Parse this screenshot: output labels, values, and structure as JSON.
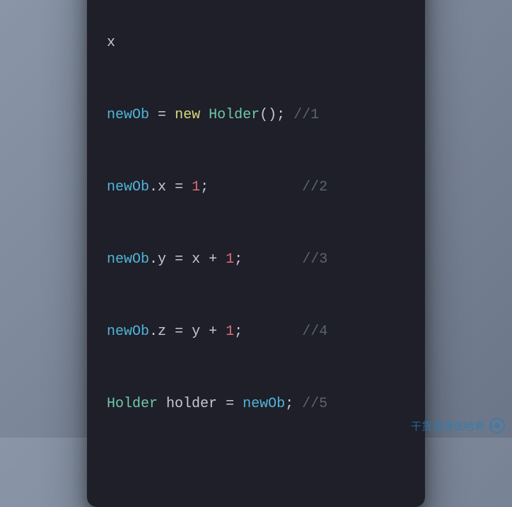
{
  "colors": {
    "background_gradient_start": "#8a96a8",
    "background_gradient_end": "#6b7688",
    "window_bg": "#1e1f29",
    "dot_red": "#ff5f56",
    "dot_yellow": "#ffbd2e",
    "dot_green": "#27c93f",
    "variable": "#50b5d8",
    "keyword": "#d9d97a",
    "type": "#6fc7a9",
    "number": "#e06c75",
    "comment": "#5c6370",
    "default": "#c5c8d4"
  },
  "traffic": {
    "red": "close",
    "yellow": "minimize",
    "green": "zoom"
  },
  "code": {
    "line0": {
      "a": "x"
    },
    "line1": {
      "var": "newOb",
      "sp1": " ",
      "eq": "=",
      "sp2": " ",
      "kw": "new",
      "sp3": " ",
      "fn": "Holder",
      "call": "();",
      "sp4": " ",
      "cmt": "//1"
    },
    "line2": {
      "var": "newOb",
      "dot": ".",
      "prop": "x",
      "sp1": " ",
      "eq": "=",
      "sp2": " ",
      "num": "1",
      "semi": ";",
      "pad": "           ",
      "cmt": "//2"
    },
    "line3": {
      "var": "newOb",
      "dot": ".",
      "prop": "y",
      "sp1": " ",
      "eq": "=",
      "sp2": " ",
      "rhs1": "x",
      "sp3": " ",
      "plus": "+",
      "sp4": " ",
      "num": "1",
      "semi": ";",
      "pad": "       ",
      "cmt": "//3"
    },
    "line4": {
      "var": "newOb",
      "dot": ".",
      "prop": "z",
      "sp1": " ",
      "eq": "=",
      "sp2": " ",
      "rhs1": "y",
      "sp3": " ",
      "plus": "+",
      "sp4": " ",
      "num": "1",
      "semi": ";",
      "pad": "       ",
      "cmt": "//4"
    },
    "line5": {
      "type": "Holder",
      "sp1": " ",
      "id": "holder",
      "sp2": " ",
      "eq": "=",
      "sp3": " ",
      "rhs": "newOb",
      "semi": ";",
      "sp4": " ",
      "cmt": "//5"
    }
  },
  "watermark": {
    "text": "干货满满张哈希"
  }
}
